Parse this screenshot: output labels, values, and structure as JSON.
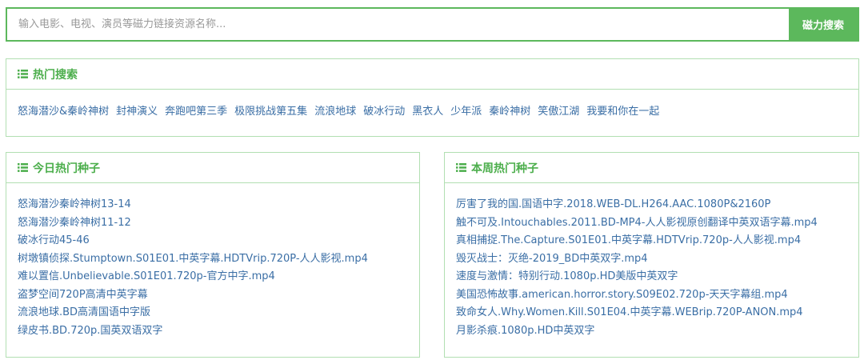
{
  "search": {
    "placeholder": "输入电影、电视、演员等磁力链接资源名称...",
    "value": "",
    "button_label": "磁力搜索"
  },
  "hot_search": {
    "title": "热门搜索",
    "icon": "list-icon",
    "links": [
      "怒海潜沙&秦岭神树",
      "封神演义",
      "奔跑吧第三季",
      "极限挑战第五集",
      "流浪地球",
      "破冰行动",
      "黑衣人",
      "少年派",
      "秦岭神树",
      "笑傲江湖",
      "我要和你在一起"
    ]
  },
  "today_seeds": {
    "title": "今日热门种子",
    "icon": "list-icon",
    "items": [
      "怒海潜沙秦岭神树13-14",
      "怒海潜沙秦岭神树11-12",
      "破冰行动45-46",
      "树墩镇侦探.Stumptown.S01E01.中英字幕.HDTVrip.720P-人人影视.mp4",
      "难以置信.Unbelievable.S01E01.720p-官方中字.mp4",
      "盗梦空间720P高清中英字幕",
      "流浪地球.BD高清国语中字版",
      "绿皮书.BD.720p.国英双语双字"
    ]
  },
  "week_seeds": {
    "title": "本周热门种子",
    "icon": "list-icon",
    "items": [
      "厉害了我的国.国语中字.2018.WEB-DL.H264.AAC.1080P&2160P",
      "触不可及.Intouchables.2011.BD-MP4-人人影视原创翻译中英双语字幕.mp4",
      "真相捕捉.The.Capture.S01E01.中英字幕.HDTVrip.720p-人人影视.mp4",
      "毁灭战士：灭绝-2019_BD中英双字.mp4",
      "速度与激情：特别行动.1080p.HD美版中英双字",
      "美国恐怖故事.american.horror.story.S09E02.720p-天天字幕组.mp4",
      "致命女人.Why.Women.Kill.S01E04.中英字幕.WEBrip.720P-ANON.mp4",
      "月影杀痕.1080p.HD中英双字"
    ]
  },
  "colors": {
    "accent": "#5cb85c",
    "link": "#3a6ea5",
    "border": "#b2dfb2"
  }
}
